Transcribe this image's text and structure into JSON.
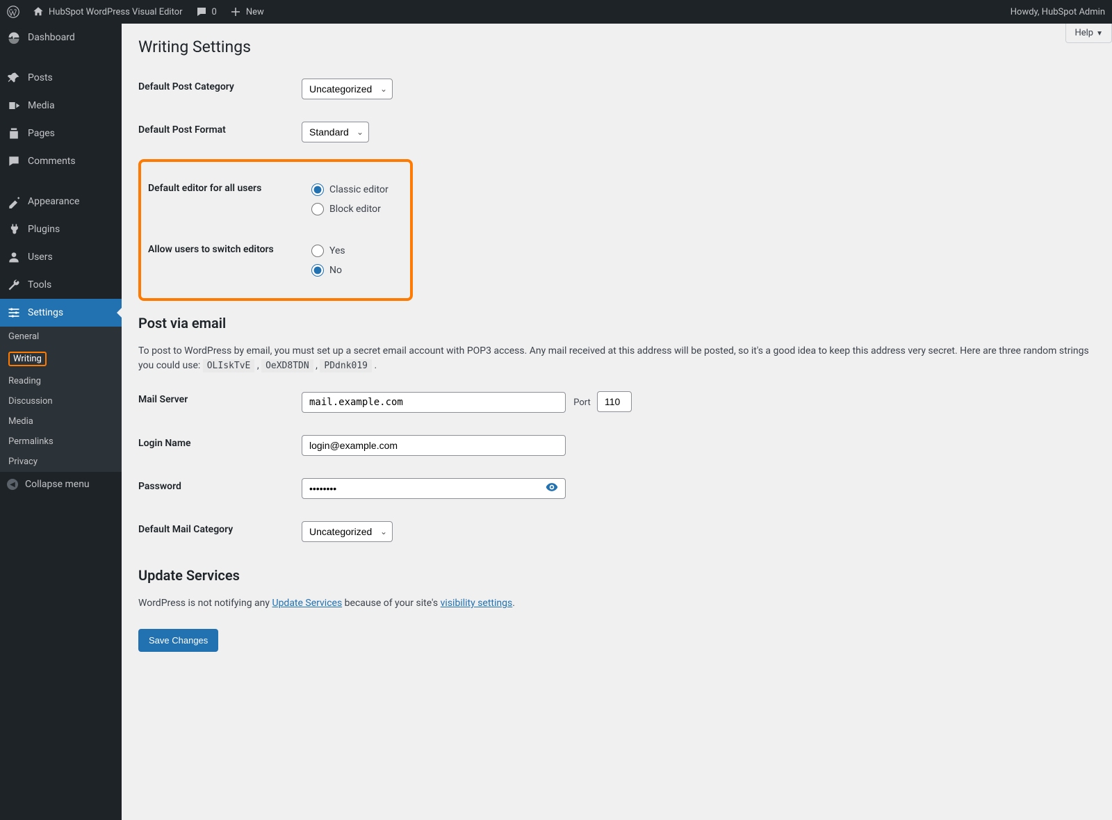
{
  "adminbar": {
    "site_title": "HubSpot WordPress Visual Editor",
    "comments_count": "0",
    "new_label": "New",
    "howdy": "Howdy, HubSpot Admin"
  },
  "help_label": "Help",
  "sidebar": {
    "items": [
      {
        "label": "Dashboard",
        "icon": "dashboard"
      },
      {
        "label": "Posts",
        "icon": "pin"
      },
      {
        "label": "Media",
        "icon": "media"
      },
      {
        "label": "Pages",
        "icon": "pages"
      },
      {
        "label": "Comments",
        "icon": "comment"
      },
      {
        "label": "Appearance",
        "icon": "appearance"
      },
      {
        "label": "Plugins",
        "icon": "plugins"
      },
      {
        "label": "Users",
        "icon": "users"
      },
      {
        "label": "Tools",
        "icon": "tools"
      },
      {
        "label": "Settings",
        "icon": "settings"
      }
    ],
    "submenu": [
      {
        "label": "General"
      },
      {
        "label": "Writing",
        "highlighted": true
      },
      {
        "label": "Reading"
      },
      {
        "label": "Discussion"
      },
      {
        "label": "Media"
      },
      {
        "label": "Permalinks"
      },
      {
        "label": "Privacy"
      }
    ],
    "collapse_label": "Collapse menu"
  },
  "page": {
    "title": "Writing Settings",
    "labels": {
      "default_category": "Default Post Category",
      "default_format": "Default Post Format",
      "default_editor": "Default editor for all users",
      "allow_switch": "Allow users to switch editors",
      "post_via_email": "Post via email",
      "mail_server": "Mail Server",
      "port": "Port",
      "login_name": "Login Name",
      "password": "Password",
      "default_mail_category": "Default Mail Category",
      "update_services": "Update Services"
    },
    "values": {
      "default_category": "Uncategorized",
      "default_format": "Standard",
      "editor_options": {
        "classic": "Classic editor",
        "block": "Block editor"
      },
      "editor_selected": "classic",
      "switch_options": {
        "yes": "Yes",
        "no": "No"
      },
      "switch_selected": "no",
      "mail_server": "mail.example.com",
      "port": "110",
      "login_name": "login@example.com",
      "password": "password",
      "default_mail_category": "Uncategorized"
    },
    "email_blurb_prefix": "To post to WordPress by email, you must set up a secret email account with POP3 access. Any mail received at this address will be posted, so it's a good idea to keep this address very secret. Here are three random strings you could use: ",
    "random_strings": [
      "OLIskTvE",
      "OeXD8TDN",
      "PDdnk019"
    ],
    "update_blurb": {
      "prefix": "WordPress is not notifying any ",
      "link1": "Update Services",
      "mid": " because of your site's ",
      "link2": "visibility settings",
      "suffix": "."
    },
    "save_button": "Save Changes"
  }
}
